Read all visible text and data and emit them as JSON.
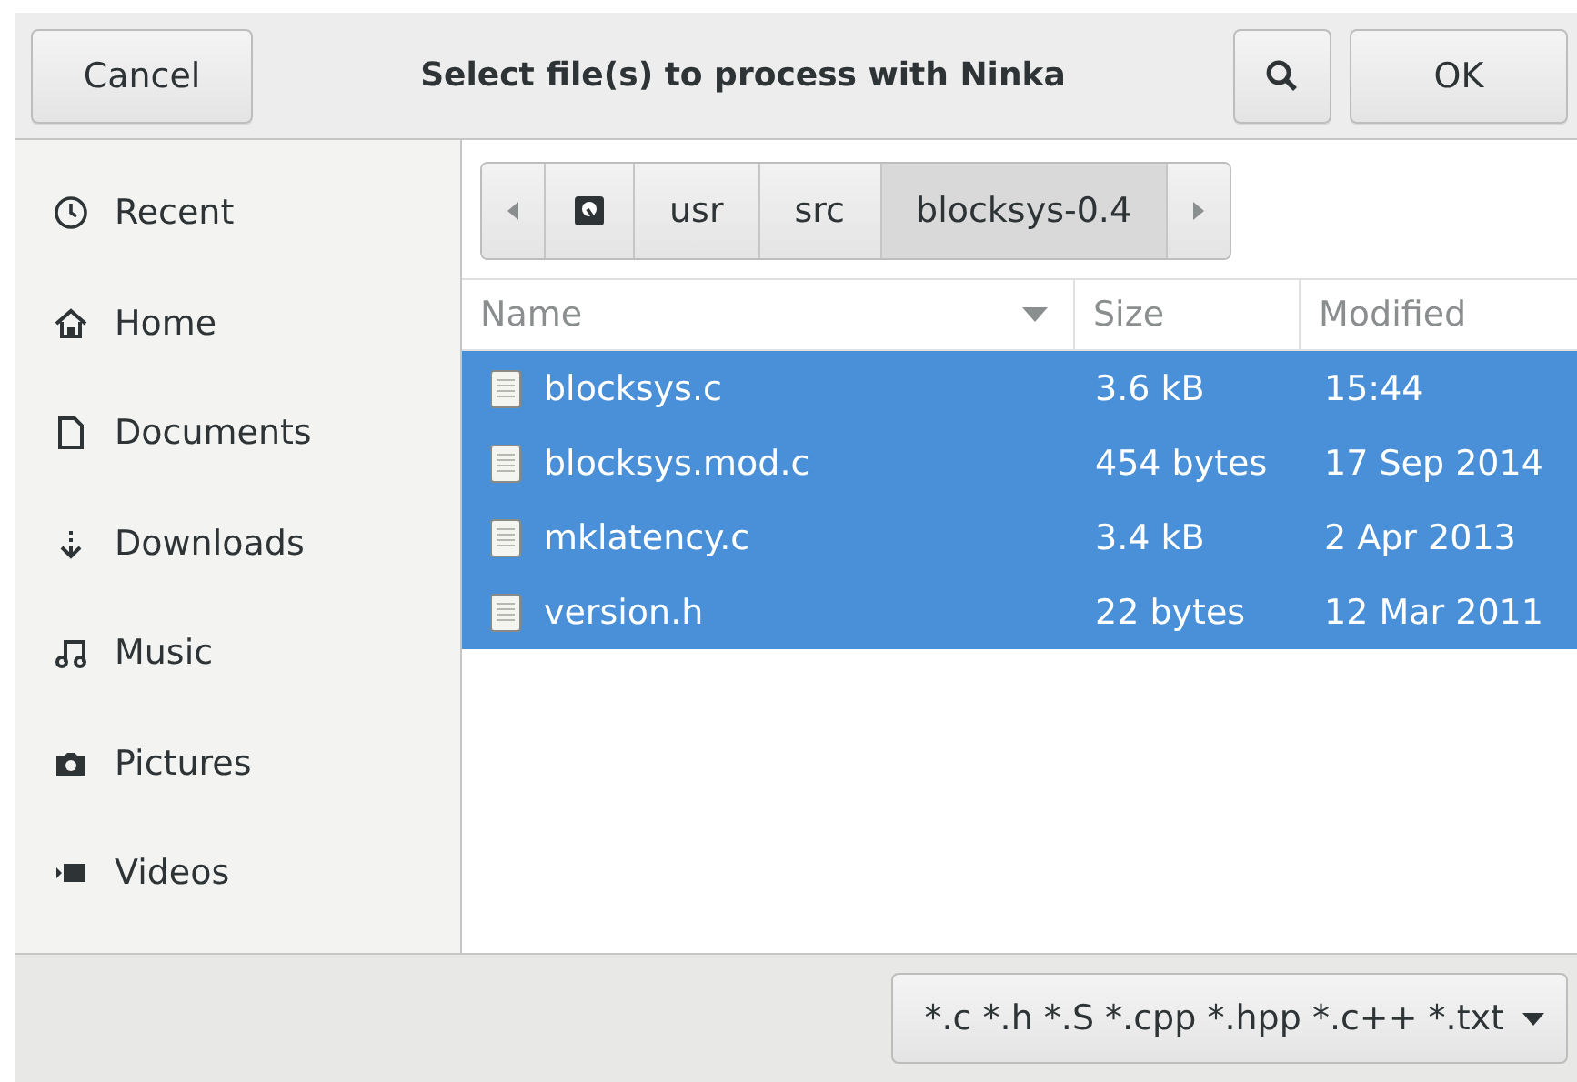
{
  "header": {
    "cancel": "Cancel",
    "title": "Select file(s) to process with Ninka",
    "ok": "OK"
  },
  "sidebar": {
    "items": [
      {
        "kind": "recent",
        "label": "Recent"
      },
      {
        "kind": "home",
        "label": "Home"
      },
      {
        "kind": "documents",
        "label": "Documents"
      },
      {
        "kind": "downloads",
        "label": "Downloads"
      },
      {
        "kind": "music",
        "label": "Music"
      },
      {
        "kind": "pictures",
        "label": "Pictures"
      },
      {
        "kind": "videos",
        "label": "Videos"
      }
    ]
  },
  "pathbar": {
    "items": [
      {
        "kind": "drive",
        "selected": false
      },
      {
        "kind": "folder",
        "label": "usr",
        "selected": false
      },
      {
        "kind": "folder",
        "label": "src",
        "selected": false
      },
      {
        "kind": "folder",
        "label": "blocksys-0.4",
        "selected": true
      }
    ]
  },
  "table": {
    "columns": [
      "Name",
      "Size",
      "Modified"
    ],
    "rows": [
      {
        "name": "blocksys.c",
        "size": "3.6 kB",
        "modified": "15:44",
        "selected": true
      },
      {
        "name": "blocksys.mod.c",
        "size": "454 bytes",
        "modified": "17 Sep 2014",
        "selected": true
      },
      {
        "name": "mklatency.c",
        "size": "3.4 kB",
        "modified": "2 Apr 2013",
        "selected": true
      },
      {
        "name": "version.h",
        "size": "22 bytes",
        "modified": "12 Mar 2011",
        "selected": true
      }
    ]
  },
  "filter": {
    "label": "*.c *.h *.S *.cpp *.hpp *.c++ *.txt"
  }
}
